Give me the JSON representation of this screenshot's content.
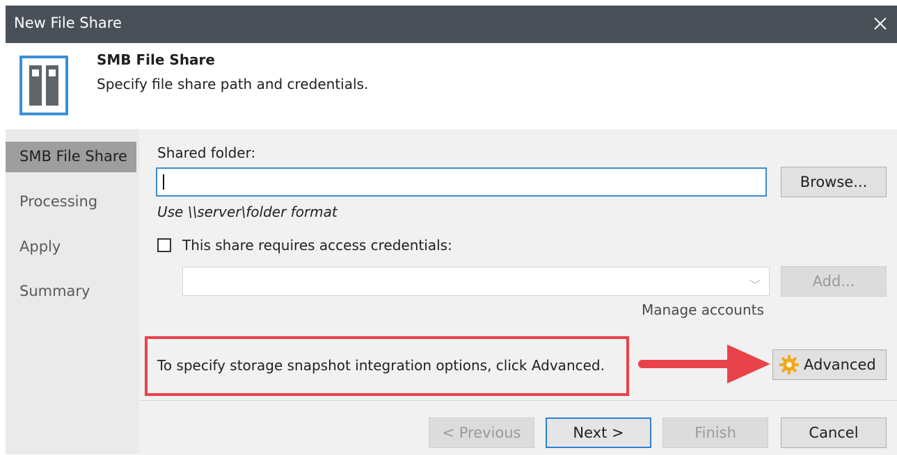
{
  "window": {
    "title": "New File Share",
    "close_glyph": "✕"
  },
  "header": {
    "title": "SMB File Share",
    "subtitle": "Specify file share path and credentials.",
    "icon": "file-share-icon"
  },
  "nav": {
    "items": [
      {
        "label": "SMB File Share",
        "active": true
      },
      {
        "label": "Processing",
        "active": false
      },
      {
        "label": "Apply",
        "active": false
      },
      {
        "label": "Summary",
        "active": false
      }
    ]
  },
  "form": {
    "shared_folder_label": "Shared folder:",
    "shared_folder_value": "",
    "browse_label": "Browse...",
    "format_hint": "Use \\\\server\\folder format",
    "credentials_checkbox_label": "This share requires access credentials:",
    "credentials_checked": false,
    "credentials_value": "",
    "add_label": "Add...",
    "manage_accounts_label": "Manage accounts",
    "advanced_hint": "To specify storage snapshot integration options, click Advanced.",
    "advanced_label": "Advanced"
  },
  "footer": {
    "previous_label": "< Previous",
    "next_label": "Next >",
    "finish_label": "Finish",
    "cancel_label": "Cancel"
  },
  "colors": {
    "titlebar": "#4a5057",
    "accent": "#2f7fd1",
    "highlight": "#e8434a",
    "gear": "#f2a81d"
  }
}
